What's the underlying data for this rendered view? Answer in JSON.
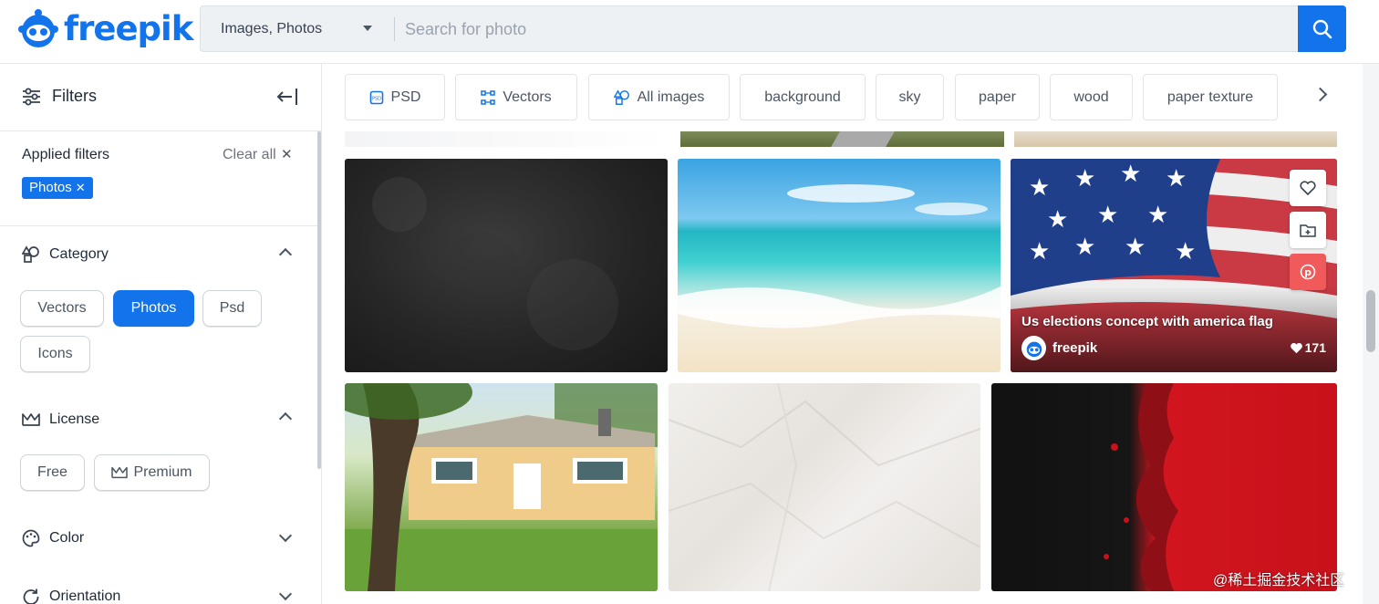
{
  "brand": {
    "name": "freepik",
    "color": "#1273eb"
  },
  "search": {
    "type_label": "Images, Photos",
    "placeholder": "Search for photo"
  },
  "sidebar": {
    "title": "Filters",
    "applied": {
      "title": "Applied filters",
      "clear_all": "Clear all",
      "chips": [
        "Photos"
      ]
    },
    "category": {
      "title": "Category",
      "options": [
        "Vectors",
        "Photos",
        "Psd",
        "Icons"
      ],
      "selected": "Photos",
      "expanded": true
    },
    "license": {
      "title": "License",
      "options": [
        "Free",
        "Premium"
      ],
      "expanded": true
    },
    "color": {
      "title": "Color",
      "expanded": false
    },
    "orientation": {
      "title": "Orientation",
      "expanded": false
    }
  },
  "tags": [
    "PSD",
    "Vectors",
    "All images",
    "background",
    "sky",
    "paper",
    "wood",
    "paper texture"
  ],
  "grid": {
    "hovered_card": {
      "title": "Us elections concept with america flag",
      "author": "freepik",
      "likes": "171"
    },
    "cards": [
      {
        "subject": "dark grunge texture"
      },
      {
        "subject": "tropical beach with turquoise sea"
      },
      {
        "subject": "american flag waving"
      },
      {
        "subject": "yellow wooden house with tree"
      },
      {
        "subject": "crumpled white paper texture"
      },
      {
        "subject": "black and red paint background"
      }
    ]
  },
  "watermark": "@稀土掘金技术社区"
}
